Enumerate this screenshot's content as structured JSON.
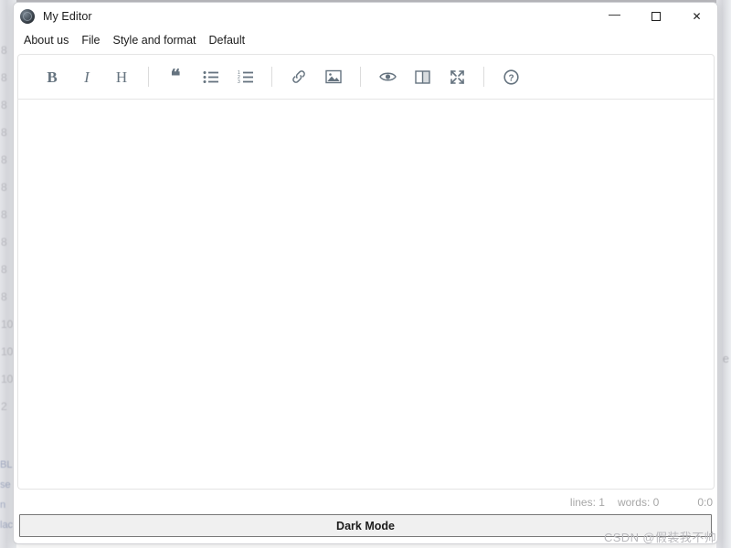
{
  "window": {
    "title": "My Editor",
    "app_icon": "app-logo-icon",
    "controls": {
      "minimize": "minimize-icon",
      "maximize": "maximize-icon",
      "close": "close-icon"
    }
  },
  "menu": {
    "items": [
      {
        "label": "About us"
      },
      {
        "label": "File"
      },
      {
        "label": "Style and format"
      },
      {
        "label": "Default"
      }
    ]
  },
  "toolbar": {
    "groups": [
      {
        "buttons": [
          {
            "icon": "bold-icon",
            "glyph": "B",
            "title": "Bold"
          },
          {
            "icon": "italic-icon",
            "glyph": "I",
            "title": "Italic"
          },
          {
            "icon": "heading-icon",
            "glyph": "H",
            "title": "Heading"
          }
        ]
      },
      {
        "buttons": [
          {
            "icon": "quote-icon",
            "glyph": "❝",
            "title": "Quote"
          },
          {
            "icon": "unordered-list-icon",
            "glyph": "",
            "title": "Bullet list"
          },
          {
            "icon": "ordered-list-icon",
            "glyph": "",
            "title": "Numbered list"
          }
        ]
      },
      {
        "buttons": [
          {
            "icon": "link-icon",
            "glyph": "",
            "title": "Link"
          },
          {
            "icon": "image-icon",
            "glyph": "",
            "title": "Image"
          }
        ]
      },
      {
        "buttons": [
          {
            "icon": "preview-eye-icon",
            "glyph": "",
            "title": "Preview"
          },
          {
            "icon": "side-by-side-icon",
            "glyph": "",
            "title": "Side by side"
          },
          {
            "icon": "fullscreen-icon",
            "glyph": "",
            "title": "Fullscreen"
          }
        ]
      },
      {
        "buttons": [
          {
            "icon": "help-icon",
            "glyph": "",
            "title": "Markdown guide"
          }
        ]
      }
    ]
  },
  "editor": {
    "content": "",
    "placeholder": ""
  },
  "status": {
    "lines_label": "lines: 1",
    "words_label": "words: 0",
    "cursor_label": "0:0"
  },
  "footer": {
    "dark_mode_label": "Dark Mode"
  },
  "watermark": {
    "text": "CSDN @假装我不帅"
  },
  "background": {
    "left_column_chars": [
      "8",
      "8",
      "8",
      "8",
      "8",
      "8",
      "8",
      "8",
      "8",
      "8",
      "10",
      "10",
      "10",
      "2"
    ],
    "purple_text": "....  ...  ..",
    "right_char": "e",
    "bottom_left_lines": [
      "BL",
      "se",
      "n",
      "lact"
    ]
  },
  "colors": {
    "icon": "#65737f",
    "accent_border": "#e4e4e4",
    "status_text": "#a7a7a7",
    "watermark": "#b9b9bd"
  }
}
